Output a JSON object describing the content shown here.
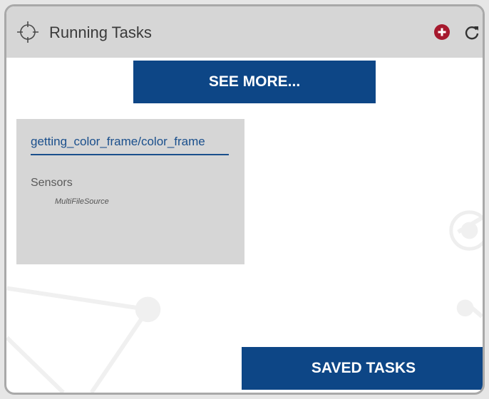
{
  "header": {
    "title": "Running Tasks",
    "crosshair_icon": "crosshair-icon",
    "add_icon": "plus-circle-icon",
    "refresh_icon": "refresh-icon"
  },
  "see_more_label": "SEE MORE...",
  "task": {
    "name": "getting_color_frame/color_frame",
    "sensors_label": "Sensors",
    "sensor_source": "MultiFileSource"
  },
  "saved_tasks_label": "SAVED TASKS",
  "colors": {
    "accent_blue": "#0d4686",
    "add_red": "#a6192e",
    "header_gray": "#d6d6d6"
  }
}
